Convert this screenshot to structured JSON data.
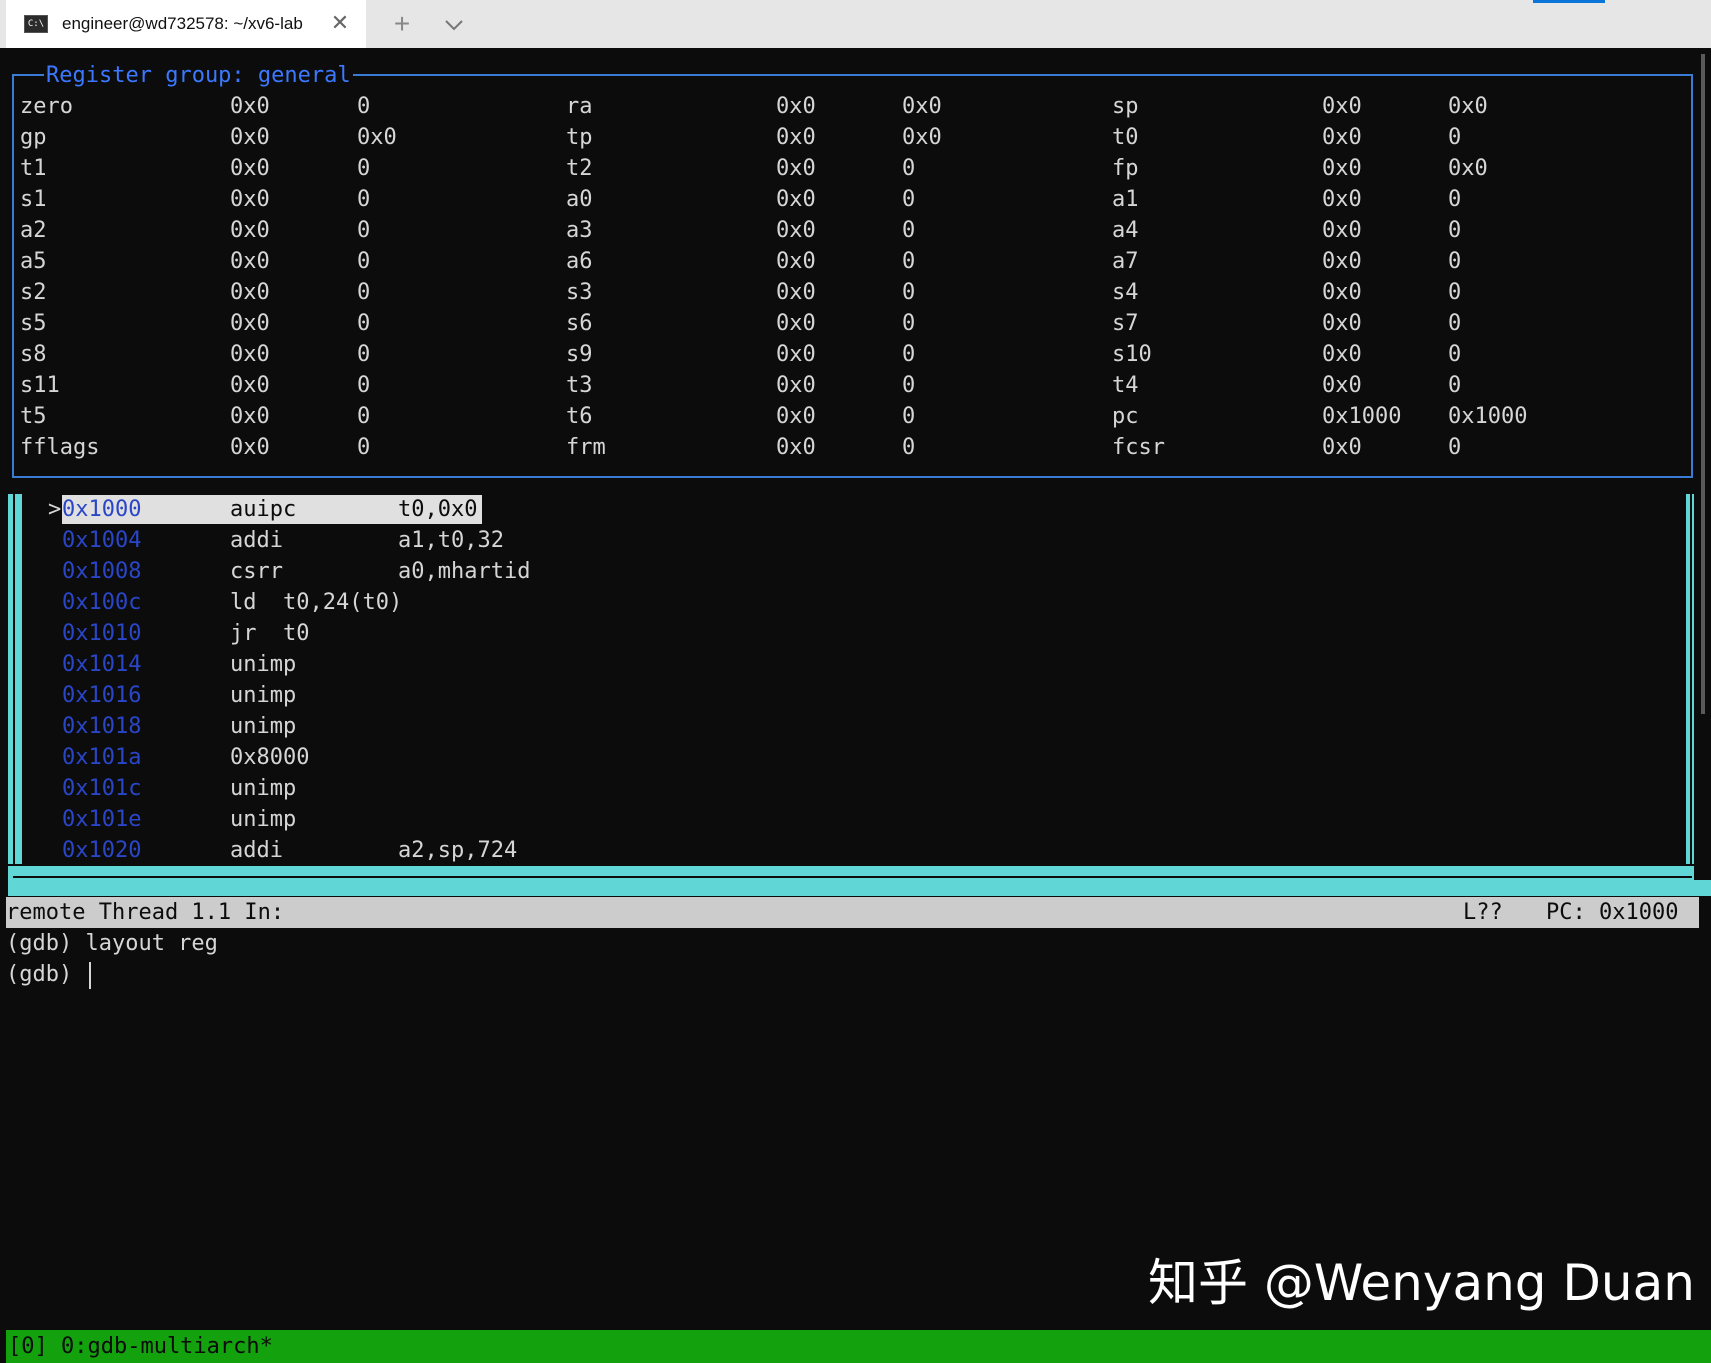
{
  "window": {
    "tab_title": "engineer@wd732578: ~/xv6-lab",
    "tab_icon": "terminal-icon",
    "new_tab_symbol": "+",
    "close_symbol": "✕"
  },
  "registers": {
    "title": "Register group: general",
    "rows": [
      [
        [
          "zero",
          "0x0",
          "0"
        ],
        [
          "ra",
          "0x0",
          "0x0"
        ],
        [
          "sp",
          "0x0",
          "0x0"
        ]
      ],
      [
        [
          "gp",
          "0x0",
          "0x0"
        ],
        [
          "tp",
          "0x0",
          "0x0"
        ],
        [
          "t0",
          "0x0",
          "0"
        ]
      ],
      [
        [
          "t1",
          "0x0",
          "0"
        ],
        [
          "t2",
          "0x0",
          "0"
        ],
        [
          "fp",
          "0x0",
          "0x0"
        ]
      ],
      [
        [
          "s1",
          "0x0",
          "0"
        ],
        [
          "a0",
          "0x0",
          "0"
        ],
        [
          "a1",
          "0x0",
          "0"
        ]
      ],
      [
        [
          "a2",
          "0x0",
          "0"
        ],
        [
          "a3",
          "0x0",
          "0"
        ],
        [
          "a4",
          "0x0",
          "0"
        ]
      ],
      [
        [
          "a5",
          "0x0",
          "0"
        ],
        [
          "a6",
          "0x0",
          "0"
        ],
        [
          "a7",
          "0x0",
          "0"
        ]
      ],
      [
        [
          "s2",
          "0x0",
          "0"
        ],
        [
          "s3",
          "0x0",
          "0"
        ],
        [
          "s4",
          "0x0",
          "0"
        ]
      ],
      [
        [
          "s5",
          "0x0",
          "0"
        ],
        [
          "s6",
          "0x0",
          "0"
        ],
        [
          "s7",
          "0x0",
          "0"
        ]
      ],
      [
        [
          "s8",
          "0x0",
          "0"
        ],
        [
          "s9",
          "0x0",
          "0"
        ],
        [
          "s10",
          "0x0",
          "0"
        ]
      ],
      [
        [
          "s11",
          "0x0",
          "0"
        ],
        [
          "t3",
          "0x0",
          "0"
        ],
        [
          "t4",
          "0x0",
          "0"
        ]
      ],
      [
        [
          "t5",
          "0x0",
          "0"
        ],
        [
          "t6",
          "0x0",
          "0"
        ],
        [
          "pc",
          "0x1000",
          "0x1000"
        ]
      ],
      [
        [
          "fflags",
          "0x0",
          "0"
        ],
        [
          "frm",
          "0x0",
          "0"
        ],
        [
          "fcsr",
          "0x0",
          "0"
        ]
      ]
    ]
  },
  "assembly": {
    "current_marker": ">",
    "lines": [
      {
        "addr": "0x1000",
        "op": "auipc",
        "args": "t0,0x0"
      },
      {
        "addr": "0x1004",
        "op": "addi",
        "args": "a1,t0,32"
      },
      {
        "addr": "0x1008",
        "op": "csrr",
        "args": "a0,mhartid"
      },
      {
        "addr": "0x100c",
        "op": "ld  t0,24(t0)",
        "args": ""
      },
      {
        "addr": "0x1010",
        "op": "jr  t0",
        "args": ""
      },
      {
        "addr": "0x1014",
        "op": "unimp",
        "args": ""
      },
      {
        "addr": "0x1016",
        "op": "unimp",
        "args": ""
      },
      {
        "addr": "0x1018",
        "op": "unimp",
        "args": ""
      },
      {
        "addr": "0x101a",
        "op": "0x8000",
        "args": ""
      },
      {
        "addr": "0x101c",
        "op": "unimp",
        "args": ""
      },
      {
        "addr": "0x101e",
        "op": "unimp",
        "args": ""
      },
      {
        "addr": "0x1020",
        "op": "addi",
        "args": "a2,sp,724"
      }
    ]
  },
  "status": {
    "left": "remote Thread 1.1 In:",
    "line": "L??",
    "pc": "PC: 0x1000"
  },
  "console": {
    "lines": [
      "(gdb) layout reg",
      "(gdb) "
    ]
  },
  "watermark": "知乎 @Wenyang Duan",
  "tmux": {
    "status": "[0] 0:gdb-multiarch*"
  },
  "colors": {
    "border_blue": "#3a7bd5",
    "asm_frame": "#61d6d6",
    "tmux_green": "#13a10e",
    "address_blue": "#2a46c8"
  }
}
